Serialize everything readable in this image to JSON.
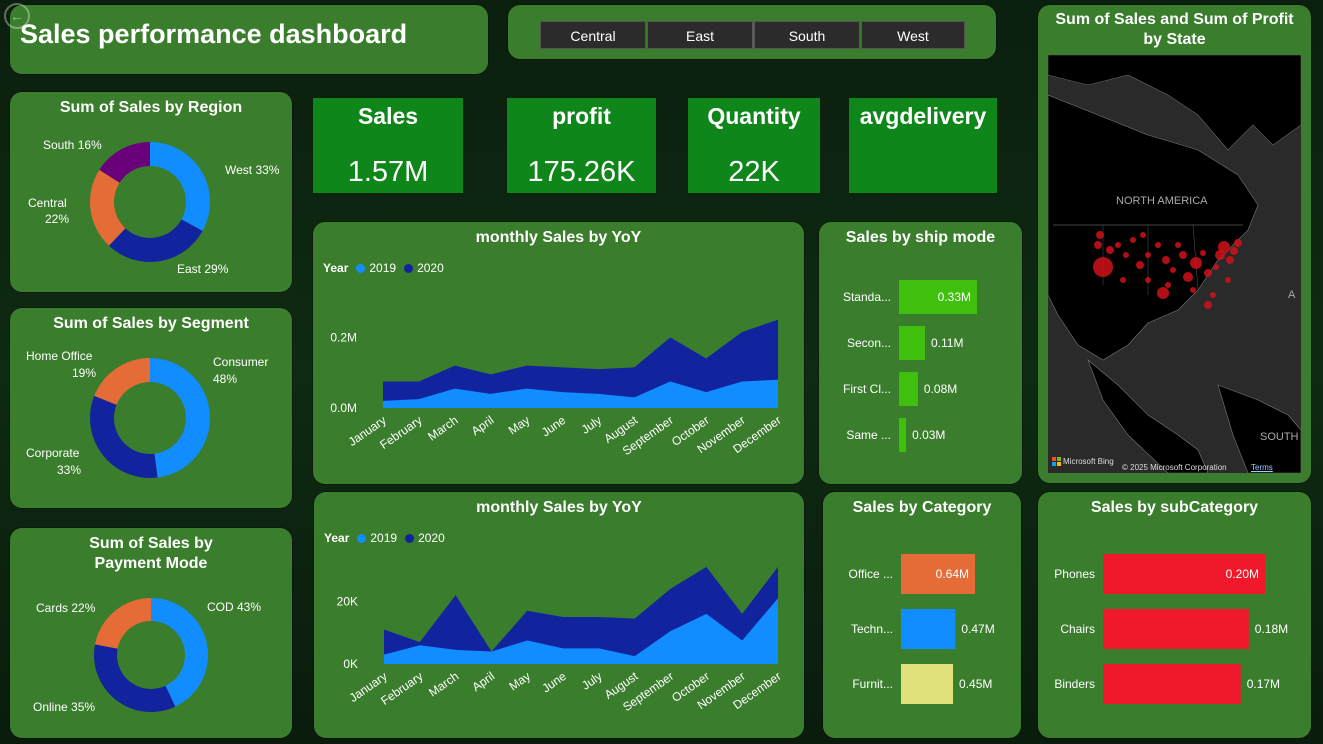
{
  "header": {
    "title": "Sales performance dashboard"
  },
  "slicer": {
    "items": [
      "Central",
      "East",
      "South",
      "West"
    ]
  },
  "kpis": [
    {
      "label": "Sales",
      "value": "1.57M"
    },
    {
      "label": "profit",
      "value": "175.26K"
    },
    {
      "label": "Quantity",
      "value": "22K"
    },
    {
      "label": "avgdelivery",
      "value": ""
    }
  ],
  "colors": {
    "bg": "#0e2a12",
    "card": "#3a7d2c",
    "kpi": "#0f861a",
    "blue_light": "#118dff",
    "blue_dark": "#12239e",
    "orange": "#e66c37",
    "purple": "#6b007b",
    "green_bar": "#3fc00c",
    "yellow": "#e1e27c",
    "red": "#f0192b"
  },
  "map": {
    "title": "Sum of Sales and Sum of Profit by State",
    "label_na": "NORTH AMERICA",
    "label_south": "SOUTH",
    "label_a": "A",
    "bing": "Microsoft Bing",
    "copyright": "© 2025 Microsoft Corporation",
    "terms": "Terms"
  },
  "chart_data": [
    {
      "id": "region",
      "type": "pie",
      "title": "Sum of Sales by Region",
      "slices": [
        {
          "label": "West",
          "pct": 33,
          "text": "West 33%"
        },
        {
          "label": "East",
          "pct": 29,
          "text": "East 29%"
        },
        {
          "label": "Central",
          "pct": 22,
          "text_a": "Central",
          "text_b": "22%"
        },
        {
          "label": "South",
          "pct": 16,
          "text": "South 16%"
        }
      ]
    },
    {
      "id": "segment",
      "type": "pie",
      "title": "Sum of Sales by Segment",
      "slices": [
        {
          "label": "Consumer",
          "pct": 48,
          "text_a": "Consumer",
          "text_b": "48%"
        },
        {
          "label": "Corporate",
          "pct": 33,
          "text_a": "Corporate",
          "text_b": "33%"
        },
        {
          "label": "Home Office",
          "pct": 19,
          "text_a": "Home Office",
          "text_b": "19%"
        }
      ]
    },
    {
      "id": "payment",
      "type": "pie",
      "title": "Sum of Sales by Payment Mode",
      "slices": [
        {
          "label": "COD",
          "pct": 43,
          "text": "COD 43%"
        },
        {
          "label": "Online",
          "pct": 35,
          "text": "Online 35%"
        },
        {
          "label": "Cards",
          "pct": 22,
          "text": "Cards 22%"
        }
      ]
    },
    {
      "id": "monthly_sales",
      "type": "area",
      "title": "monthly Sales by YoY",
      "legend_title": "Year",
      "categories": [
        "January",
        "February",
        "March",
        "April",
        "May",
        "June",
        "July",
        "August",
        "September",
        "October",
        "November",
        "December"
      ],
      "yticks": [
        "0.0M",
        "0.2M"
      ],
      "ylim": [
        0,
        0.3
      ],
      "series": [
        {
          "name": "2019",
          "values": [
            0.02,
            0.025,
            0.055,
            0.04,
            0.055,
            0.045,
            0.04,
            0.03,
            0.075,
            0.045,
            0.075,
            0.08
          ]
        },
        {
          "name": "2020",
          "values": [
            0.075,
            0.075,
            0.12,
            0.095,
            0.12,
            0.115,
            0.11,
            0.115,
            0.2,
            0.14,
            0.215,
            0.25
          ]
        }
      ]
    },
    {
      "id": "monthly_qty",
      "type": "area",
      "title": "monthly Sales by YoY",
      "legend_title": "Year",
      "categories": [
        "January",
        "February",
        "March",
        "April",
        "May",
        "June",
        "July",
        "August",
        "September",
        "October",
        "November",
        "December"
      ],
      "yticks": [
        "0K",
        "20K"
      ],
      "ylim": [
        0,
        30000
      ],
      "series": [
        {
          "name": "2019",
          "values": [
            3000,
            6000,
            4500,
            4000,
            7500,
            5000,
            5000,
            2500,
            10500,
            16000,
            7500,
            21000
          ]
        },
        {
          "name": "2020",
          "values": [
            11000,
            7000,
            22000,
            4000,
            17000,
            15000,
            15000,
            14500,
            24000,
            31000,
            16000,
            31000
          ]
        }
      ]
    },
    {
      "id": "shipmode",
      "type": "bar",
      "title": "Sales by ship mode",
      "categories": [
        "Standa...",
        "Secon...",
        "First Cl...",
        "Same ..."
      ],
      "values": [
        0.33,
        0.11,
        0.08,
        0.03
      ],
      "labels": [
        "0.33M",
        "0.11M",
        "0.08M",
        "0.03M"
      ],
      "max": 0.33
    },
    {
      "id": "category",
      "type": "bar",
      "title": "Sales by Category",
      "categories": [
        "Office ...",
        "Techn...",
        "Furnit..."
      ],
      "values": [
        0.64,
        0.47,
        0.45
      ],
      "labels": [
        "0.64M",
        "0.47M",
        "0.45M"
      ],
      "max": 0.64
    },
    {
      "id": "subcategory",
      "type": "bar",
      "title": "Sales by subCategory",
      "categories": [
        "Phones",
        "Chairs",
        "Binders"
      ],
      "values": [
        0.2,
        0.18,
        0.17
      ],
      "labels": [
        "0.20M",
        "0.18M",
        "0.17M"
      ],
      "max": 0.2
    }
  ]
}
